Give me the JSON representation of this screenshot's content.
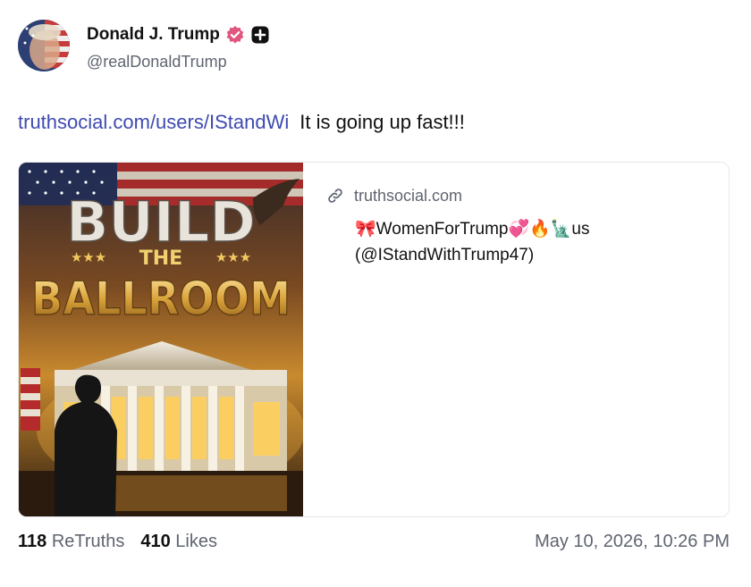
{
  "author": {
    "name": "Donald J. Trump",
    "handle": "@realDonaldTrump",
    "verified_icon": "verified-badge-icon",
    "badge_icon": "plus-badge-icon"
  },
  "post": {
    "link_text": "truthsocial.com/users/IStandWi",
    "text": "It is going up fast!!!"
  },
  "card": {
    "domain": "truthsocial.com",
    "title_line1": "🎀WomenForTrump💞🔥🗽us",
    "title_line2": "(@IStandWithTrump47)",
    "image_text_build": "BUILD",
    "image_text_the": "THE",
    "image_text_ballroom": "BALLROOM"
  },
  "stats": {
    "retruths_count": "118",
    "retruths_label": "ReTruths",
    "likes_count": "410",
    "likes_label": "Likes"
  },
  "timestamp": "May 10, 2026, 10:26 PM",
  "colors": {
    "link": "#3e4bb0",
    "verified": "#e0567f",
    "muted": "#5f6470"
  }
}
